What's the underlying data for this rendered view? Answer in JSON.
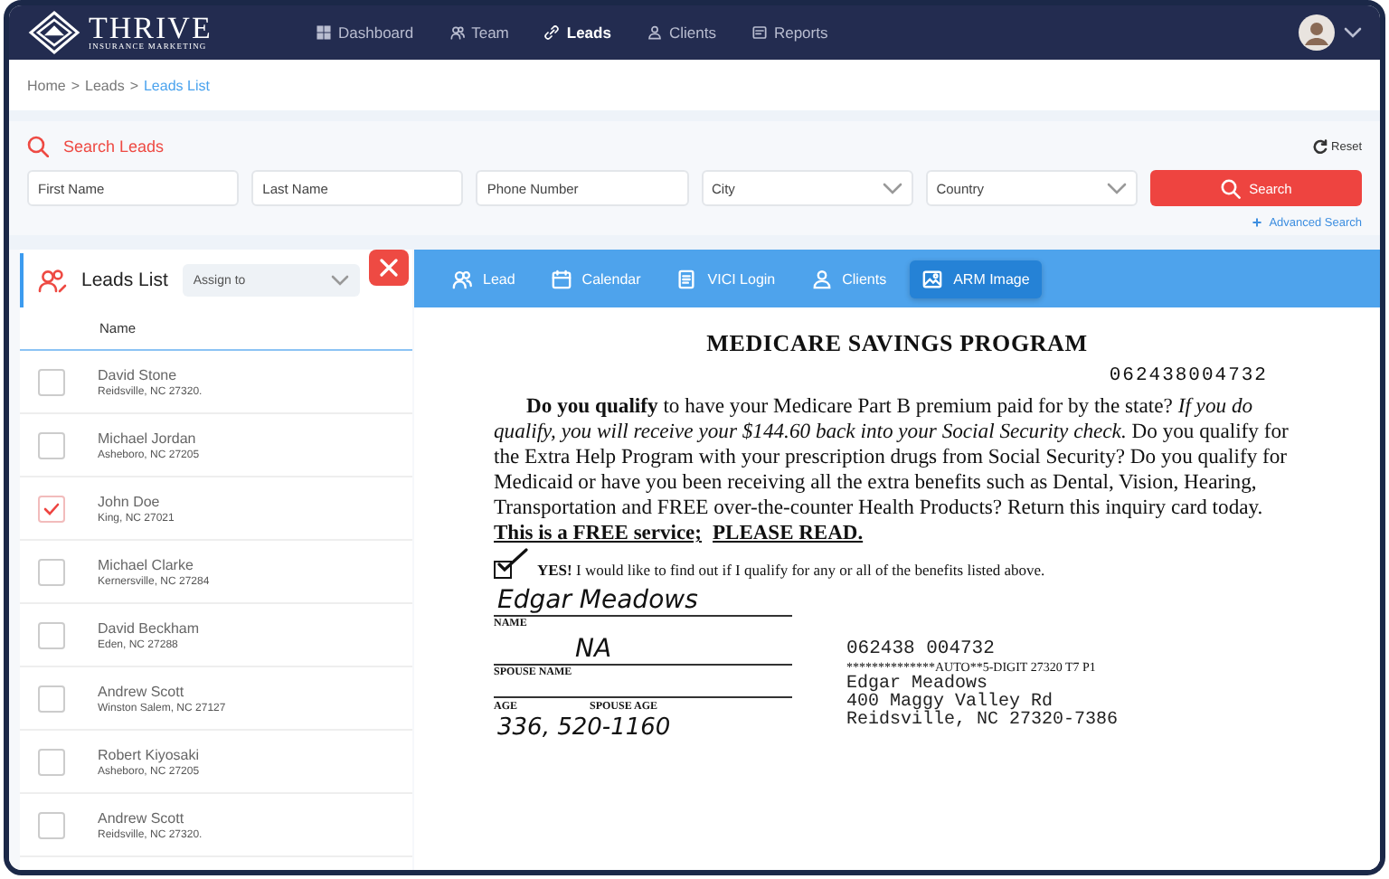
{
  "nav": {
    "logo": {
      "title": "THRIVE",
      "subtitle": "INSURANCE MARKETING"
    },
    "items": [
      {
        "label": "Dashboard",
        "kind": "grid",
        "selected": false
      },
      {
        "label": "Team",
        "kind": "team",
        "selected": false
      },
      {
        "label": "Leads",
        "kind": "link",
        "selected": true
      },
      {
        "label": "Clients",
        "kind": "user",
        "selected": false
      },
      {
        "label": "Reports",
        "kind": "report",
        "selected": false
      }
    ]
  },
  "breadcrumb": {
    "separator": ">",
    "items": [
      {
        "label": "Home",
        "current": false
      },
      {
        "label": "Leads",
        "current": false
      },
      {
        "label": "Leads List",
        "current": true
      }
    ]
  },
  "search": {
    "title": "Search Leads",
    "reset": "Reset",
    "fields": [
      {
        "kind": "input",
        "placeholder": "First Name"
      },
      {
        "kind": "input",
        "placeholder": "Last Name"
      },
      {
        "kind": "input",
        "placeholder": "Phone Number"
      },
      {
        "kind": "select",
        "placeholder": "City"
      },
      {
        "kind": "select",
        "placeholder": "Country"
      }
    ],
    "button": "Search",
    "advanced": {
      "icon": "+",
      "label": "Advanced Search"
    }
  },
  "leads_list": {
    "title": "Leads List",
    "assign": {
      "placeholder": "Assign to"
    },
    "column": "Name",
    "rows": [
      {
        "name": "David Stone",
        "location": "Reidsville, NC 27320.",
        "checked": false
      },
      {
        "name": "Michael Jordan",
        "location": "Asheboro, NC 27205",
        "checked": false
      },
      {
        "name": "John Doe",
        "location": "King, NC 27021",
        "checked": true
      },
      {
        "name": "Michael Clarke",
        "location": "Kernersville, NC 27284",
        "checked": false
      },
      {
        "name": "David Beckham",
        "location": "Eden, NC 27288",
        "checked": false
      },
      {
        "name": "Andrew Scott",
        "location": "Winston Salem, NC 27127",
        "checked": false
      },
      {
        "name": "Robert Kiyosaki",
        "location": "Asheboro, NC 27205",
        "checked": false
      },
      {
        "name": "Andrew Scott",
        "location": "Reidsville, NC 27320.",
        "checked": false
      }
    ]
  },
  "detail": {
    "tabs": [
      {
        "label": "Lead",
        "kind": "team",
        "selected": false
      },
      {
        "label": "Calendar",
        "kind": "calendar",
        "selected": false
      },
      {
        "label": "VICI Login",
        "kind": "doc",
        "selected": false
      },
      {
        "label": "Clients",
        "kind": "user",
        "selected": false
      },
      {
        "label": "ARM Image",
        "kind": "image",
        "selected": true
      }
    ],
    "document": {
      "title": "MEDICARE SAVINGS PROGRAM",
      "code": "062438004732",
      "paragraph": "**Do you qualify** to have your Medicare Part B premium paid for by the state? *If you do qualify, you will receive your $144.60 back into your Social Security check.* Do you qualify for the Extra Help Program with your prescription drugs from Social Security? Do you qualify for Medicaid or have you been receiving all the extra benefits such as Dental, Vision, Hearing, Transportation and FREE over-the-counter Health Products? Return this inquiry card today.",
      "notice": [
        "This is a FREE service;",
        "PLEASE READ."
      ],
      "consent": {
        "checked": true,
        "text": "**YES!** I would like to find out if I qualify for any or all of the benefits listed above."
      },
      "fields": [
        {
          "value": "Edgar Meadows",
          "label": "NAME"
        },
        {
          "value": "NA",
          "label": "SPOUSE NAME"
        }
      ],
      "age_labels": [
        "AGE",
        "SPOUSE AGE"
      ],
      "phone": "336, 520-1160",
      "address": {
        "code": "062438 004732",
        "sort_line": "**************AUTO**5-DIGIT 27320   T7 P1",
        "lines": [
          "Edgar Meadows",
          "400 Maggy Valley Rd",
          "Reidsville, NC  27320-7386"
        ]
      }
    }
  }
}
